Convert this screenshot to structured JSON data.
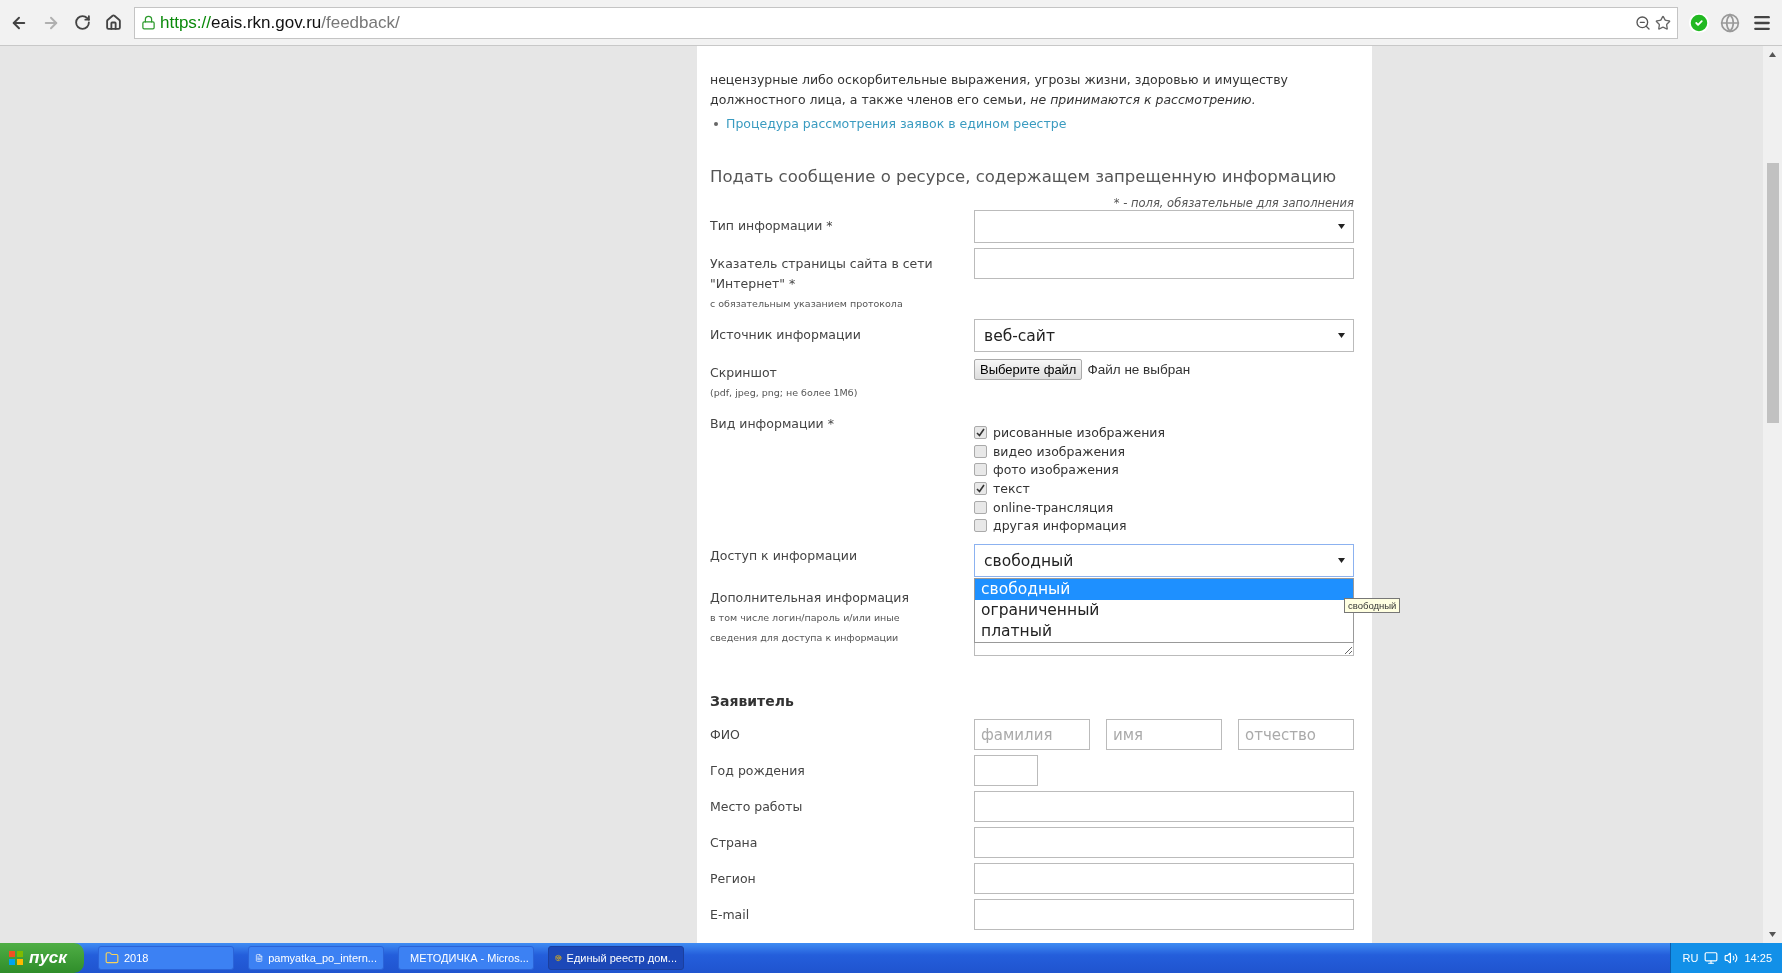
{
  "browser": {
    "url": {
      "scheme": "https://",
      "host": "eais.rkn.gov.ru",
      "path": "/feedback/"
    }
  },
  "intro": {
    "paragraph": "нецензурные либо оскорбительные выражения, угрозы жизни, здоровью и имуществу\nдолжностного лица, а также членов его семьи, *не принимаются к рассмотрению.*",
    "link": "Процедура рассмотрения заявок в едином реестре"
  },
  "form": {
    "title": "Подать сообщение о ресурсе, содержащем запрещенную информацию",
    "required_note": "* - поля, обязательные для заполнения",
    "fields": [
      {
        "kind": "select",
        "label": "Тип информации *"
      },
      {
        "kind": "text",
        "label": "Указатель страницы сайта в сети \"Интернет\" *",
        "hint": "с обязательным указанием протокола"
      },
      {
        "kind": "select",
        "label": "Источник информации",
        "value": "веб-сайт"
      },
      {
        "kind": "file",
        "label": "Скриншот",
        "hint": "(pdf, jpeg, png; не более 1Мб)",
        "button": "Выберите файл",
        "status": "Файл не выбран"
      },
      {
        "kind": "checkboxes",
        "label": "Вид информации *",
        "options": [
          {
            "label": "рисованные изображения",
            "checked": true
          },
          {
            "label": "видео изображения",
            "checked": false
          },
          {
            "label": "фото изображения",
            "checked": false
          },
          {
            "label": "текст",
            "checked": true
          },
          {
            "label": "online-трансляция",
            "checked": false
          },
          {
            "label": "другая информация",
            "checked": false
          }
        ]
      },
      {
        "kind": "open_select",
        "label": "Доступ к информации",
        "value": "свободный",
        "options": [
          {
            "label": "свободный",
            "selected": true
          },
          {
            "label": "ограниченный",
            "selected": false
          },
          {
            "label": "платный",
            "selected": false
          }
        ],
        "tooltip": "свободный"
      },
      {
        "kind": "textarea",
        "label": "Дополнительная информация",
        "hint": "в том числе логин/пароль и/или иные сведения для доступа к информации"
      }
    ]
  },
  "applicant": {
    "title": "Заявитель",
    "fields": [
      {
        "kind": "triple",
        "label": "ФИО",
        "placeholders": [
          "фамилия",
          "имя",
          "отчество"
        ]
      },
      {
        "kind": "short",
        "label": "Год рождения"
      },
      {
        "kind": "text",
        "label": "Место работы"
      },
      {
        "kind": "text",
        "label": "Страна"
      },
      {
        "kind": "text",
        "label": "Регион"
      },
      {
        "kind": "text",
        "label": "E-mail"
      }
    ]
  },
  "taskbar": {
    "start": "пуск",
    "items": [
      {
        "label": "2018",
        "kind": "folder",
        "selected": false
      },
      {
        "label": "pamyatka_po_intern...",
        "kind": "word",
        "selected": false
      },
      {
        "label": "МЕТОДИЧКА - Micros...",
        "kind": "word",
        "selected": false
      },
      {
        "label": "Единый реестр дом...",
        "kind": "browser",
        "selected": true
      }
    ],
    "language": "RU",
    "clock": "14:25"
  }
}
